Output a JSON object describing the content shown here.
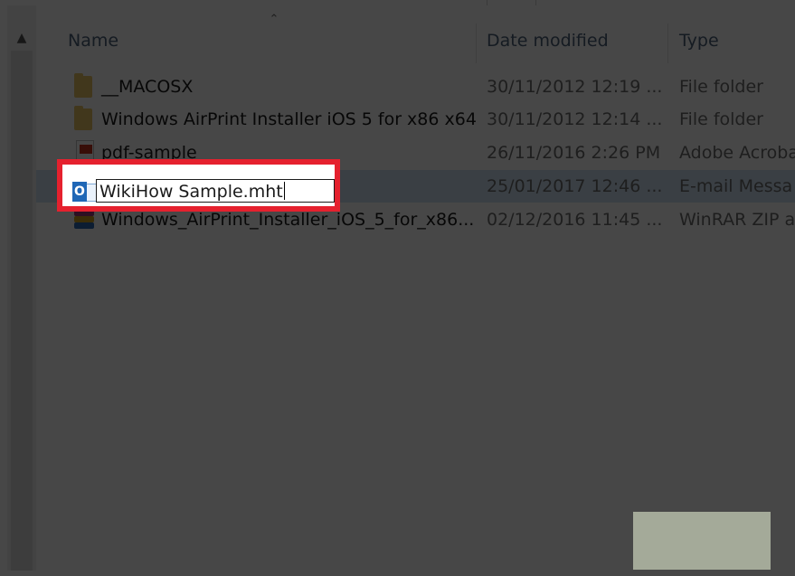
{
  "header": {
    "name": "Name",
    "date_modified": "Date modified",
    "type": "Type"
  },
  "rows": [
    {
      "name": "__MACOSX",
      "date": "30/11/2012 12:19 ...",
      "type": "File folder",
      "icon": "folder-icon"
    },
    {
      "name": "Windows AirPrint Installer iOS 5 for x86 x64",
      "date": "30/11/2012 12:14 ...",
      "type": "File folder",
      "icon": "folder-icon"
    },
    {
      "name": "pdf-sample",
      "date": "26/11/2016 2:26 PM",
      "type": "Adobe Acroba",
      "icon": "pdf-icon"
    },
    {
      "name": "WikiHow Sample.mht",
      "date": "25/01/2017 12:46 ...",
      "type": "E-mail Messa",
      "icon": "outlook-message-icon"
    },
    {
      "name": "Windows_AirPrint_Installer_iOS_5_for_x86...",
      "date": "02/12/2016 11:45 ...",
      "type": "WinRAR ZIP a",
      "icon": "winrar-archive-icon"
    }
  ],
  "rename": {
    "value": "WikiHow Sample.mht"
  },
  "colors": {
    "highlight_border": "#e5212e",
    "selected_row": "#cfe3f5",
    "header_text": "#4c607a"
  },
  "icons": {
    "scroll_up": "chevron-up-icon",
    "sort": "sort-ascending-icon"
  }
}
